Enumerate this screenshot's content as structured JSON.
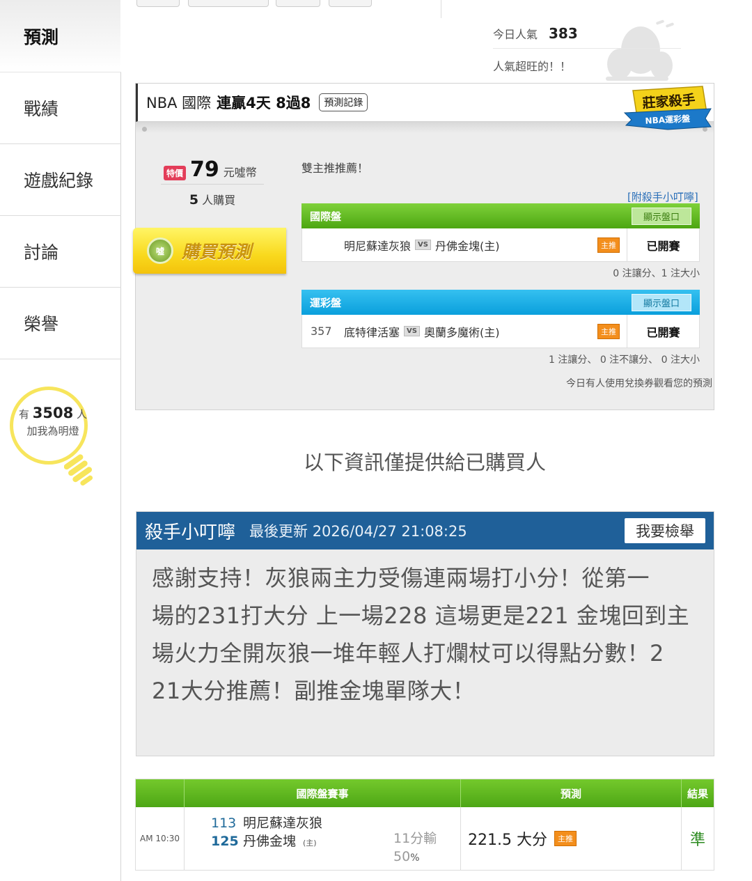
{
  "sidebar": {
    "items": [
      {
        "label": "預測"
      },
      {
        "label": "戰績"
      },
      {
        "label": "遊戲紀錄"
      },
      {
        "label": "討論"
      },
      {
        "label": "榮譽"
      }
    ],
    "fans": {
      "prefix": "有",
      "count": "3508",
      "suffix": "人",
      "line2": "加我為明燈"
    }
  },
  "popularity": {
    "label": "今日人氣",
    "value": "383",
    "note": "人氣超旺的！！"
  },
  "card": {
    "league": "NBA 國際",
    "streak": "連贏4天 8過8",
    "record_button": "預測記錄",
    "badge_line1": "莊家殺手",
    "badge_line2": "NBA運彩盤",
    "price": {
      "tag": "特價",
      "amount": "79",
      "unit": "元噓幣"
    },
    "buyers": {
      "count": "5",
      "label": "人購買"
    },
    "buy_button": "購買預測",
    "buy_icon_text": "噓",
    "recommend_text": "雙主推推薦！",
    "attach_link": "[附殺手小叮嚀]",
    "boards": [
      {
        "title": "國際盤",
        "button": "顯示盤口",
        "no": "",
        "away": "明尼蘇達灰狼",
        "vs": "VS",
        "home": "丹佛金塊(主)",
        "tag": "主推",
        "status": "已開賽",
        "summary": "0 注讓分、1 注大小"
      },
      {
        "title": "運彩盤",
        "button": "顯示盤口",
        "no": "357",
        "away": "底特律活塞",
        "vs": "VS",
        "home": "奧蘭多魔術(主)",
        "tag": "主推",
        "status": "已開賽",
        "summary": "1 注讓分、 0 注不讓分、 0 注大小"
      }
    ],
    "coupon_note": "今日有人使用兌換券觀看您的預測"
  },
  "info_note": "以下資訊僅提供給已購買人",
  "comment": {
    "author": "殺手小叮嚀",
    "updated": "最後更新 2026/04/27 21:08:25",
    "report_button": "我要檢舉",
    "lines": [
      "感謝支持！灰狼兩主力受傷連兩場打小分！從第一",
      "場的231打大分 上一場228 這場更是221 金塊回到主",
      "場火力全開灰狼一堆年輕人打爛杖可以得點分數！2",
      "21大分推薦！副推金塊單隊大！"
    ]
  },
  "results": {
    "headers": {
      "time": "",
      "event": "國際盤賽事",
      "prediction": "預測",
      "result": "結果"
    },
    "row": {
      "time": "AM 10:30",
      "away_score": "113",
      "away_team": "明尼蘇達灰狼",
      "home_score": "125",
      "home_team": "丹佛金塊",
      "home_mark": "(主)",
      "spread_text": "11分輸",
      "spread_pct": "50",
      "pct_sign": "%",
      "prediction": "221.5 大分",
      "pred_tag": "主推",
      "result": "準"
    }
  },
  "colors": {
    "green_header": "#4ca611",
    "blue_header": "#0a9fdc",
    "comment_header": "#1f6099",
    "bulb": "#f7e55c",
    "buy_button": "#f9d91d",
    "main_tag": "#f38e1c",
    "result_ok": "#2b8a1f"
  },
  "icons": [
    "lightbulb-icon",
    "coin-icon",
    "vs-icon",
    "mascot-icon",
    "badge-icon"
  ]
}
